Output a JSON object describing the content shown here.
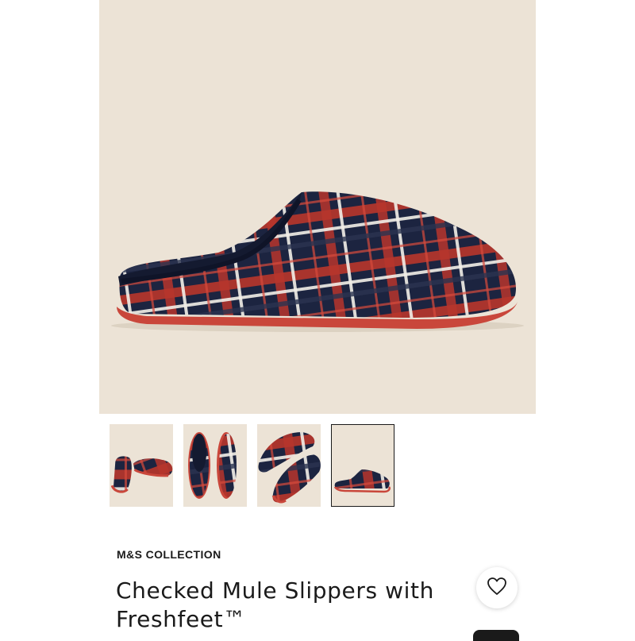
{
  "product": {
    "brand": "M&S COLLECTION",
    "title": "Checked Mule Slippers with Freshfeet™"
  },
  "hero_image": {
    "subject": "slipper-side-view"
  },
  "gallery": {
    "selected_index": 3,
    "thumbnails": [
      {
        "view": "pair-angled"
      },
      {
        "view": "top-down-pair"
      },
      {
        "view": "pair-close-up"
      },
      {
        "view": "side-view"
      }
    ]
  },
  "colors": {
    "background": "#ece3d6",
    "navy": "#1c2440",
    "red": "#c23a2e",
    "sole": "#c9473b"
  },
  "icons": {
    "wishlist": "heart-outline-icon"
  }
}
